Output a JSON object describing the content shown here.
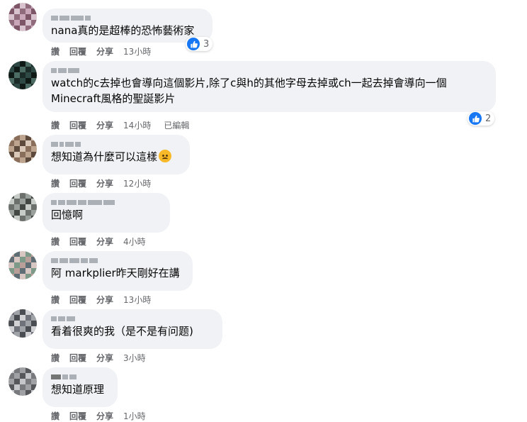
{
  "actions": {
    "like": "讚",
    "reply": "回覆",
    "share": "分享",
    "edited": "已編輯"
  },
  "comments": [
    {
      "text": "nana真的是超棒的恐怖藝術家",
      "time": "13小時",
      "reactions": "3",
      "avatar_colors": [
        "#c9a7b9",
        "#8f6b7c",
        "#d8c2cd",
        "#7c5566"
      ]
    },
    {
      "text": "watch的c去掉也會導向這個影片,除了c與h的其他字母去掉或ch一起去掉會導向一個\nMinecraft風格的聖誕影片",
      "time": "14小時",
      "reactions": "2",
      "avatar_colors": [
        "#2f4a44",
        "#1b2b27",
        "#4c6b63",
        "#0f1a17"
      ]
    },
    {
      "text": "想知道為什麼可以這樣",
      "time": "12小時",
      "avatar_colors": [
        "#bca48e",
        "#8a6e5c",
        "#d9c8b8",
        "#5d4a3c"
      ]
    },
    {
      "text": "回憶啊",
      "time": "4小時",
      "avatar_colors": [
        "#9aa09c",
        "#6b706c",
        "#c7ccc8",
        "#444845"
      ]
    },
    {
      "text": "阿 markplier昨天剛好在講",
      "time": "13小時",
      "avatar_colors": [
        "#b89f9a",
        "#7d9a88",
        "#d7c6c1",
        "#5f6d74"
      ]
    },
    {
      "text": "看着很爽的我（是不是有问题)",
      "time": "3小時",
      "avatar_colors": [
        "#a0a3a8",
        "#6f7278",
        "#cfd1d4",
        "#4a4d52"
      ]
    },
    {
      "text": "想知道原理",
      "time": "1小時",
      "avatar_colors": [
        "#9fa1a4",
        "#77797c",
        "#c4c6c9",
        "#55575a"
      ]
    }
  ]
}
